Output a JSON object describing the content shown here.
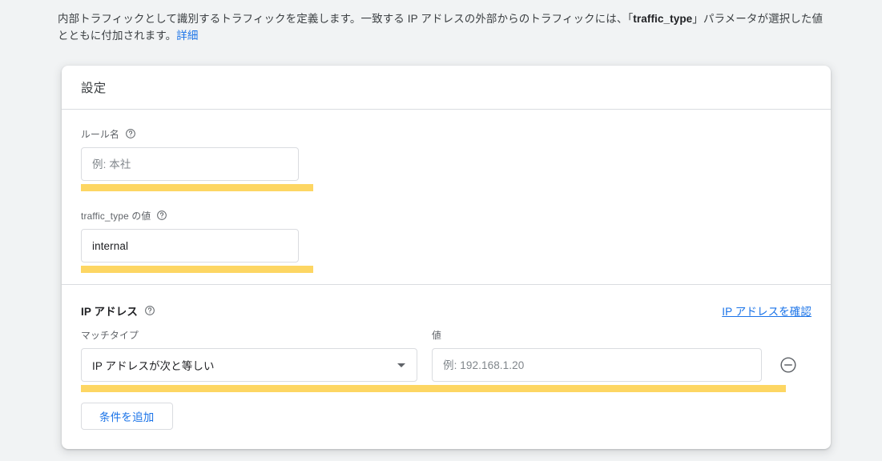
{
  "description": {
    "part1": "内部トラフィックとして識別するトラフィックを定義します。一致する IP アドレスの外部からのトラフィックには、「",
    "code_term": "traffic_type",
    "part2": "」パラメータが選択した値とともに付加されます。",
    "link_label": "詳細"
  },
  "card": {
    "title": "設定"
  },
  "rule_name": {
    "label": "ルール名",
    "help_icon": "help-circle-icon",
    "value": "",
    "placeholder": "例: 本社"
  },
  "traffic_type": {
    "label": "traffic_type の値",
    "help_icon": "help-circle-icon",
    "value": "internal",
    "placeholder": ""
  },
  "ip_section": {
    "title": "IP アドレス",
    "help_icon": "help-circle-icon",
    "check_link_label": "IP アドレスを確認",
    "match_type": {
      "label": "マッチタイプ",
      "selected": "IP アドレスが次と等しい",
      "caret_icon": "chevron-down-icon"
    },
    "value_field": {
      "label": "値",
      "value": "",
      "placeholder": "例: 192.168.1.20"
    },
    "remove_icon": "minus-circle-icon",
    "add_condition_label": "条件を追加"
  },
  "colors": {
    "page_background": "#f1f3f4",
    "card_background": "#ffffff",
    "highlight_yellow": "#fdd663",
    "link_blue": "#1a73e8",
    "divider_gray": "#dadce0",
    "label_gray": "#5f6368",
    "text_primary": "#202124"
  }
}
